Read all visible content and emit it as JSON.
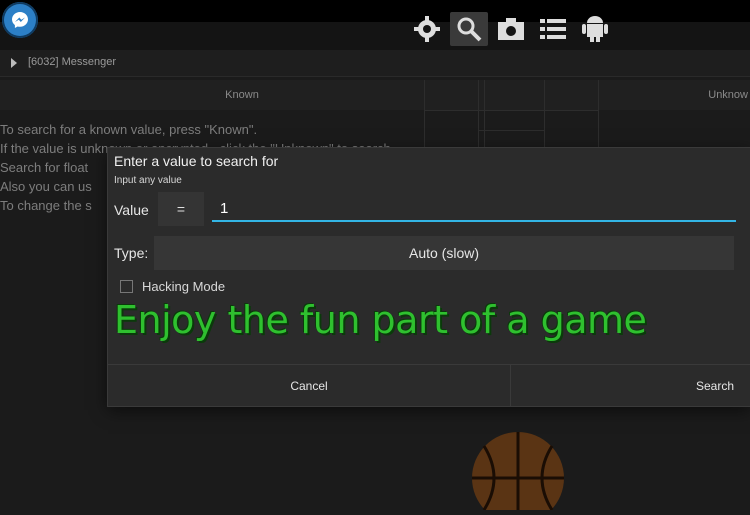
{
  "toolbar": {
    "icons": [
      "messenger-app-icon",
      "gear-icon",
      "search-icon",
      "camera-icon",
      "list-icon",
      "android-icon"
    ]
  },
  "process": {
    "name": "[6032] Messenger"
  },
  "search_modes": {
    "known": "Known",
    "unknown": "Unknow"
  },
  "help_lines": [
    "To search for a known value, press \"Known\".",
    "If the value is unknown or encrypted - click the \"Unknown\" to search",
    "Search for float",
    "Also you can us",
    "To change the s"
  ],
  "dialog": {
    "title": "Enter a value to search for",
    "subtitle": "Input any value",
    "value_label": "Value",
    "operator": "=",
    "value": "1",
    "type_label": "Type:",
    "type_value": "Auto (slow)",
    "hacking_mode_label": "Hacking Mode",
    "hacking_mode_checked": false,
    "promo_text": "Enjoy the fun part of a game",
    "cancel_label": "Cancel",
    "search_label": "Search"
  },
  "colors": {
    "accent": "#33b5e5",
    "promo_green": "#2fc02f",
    "dialog_bg": "#2b2b2b",
    "background": "#1b1b1b"
  }
}
